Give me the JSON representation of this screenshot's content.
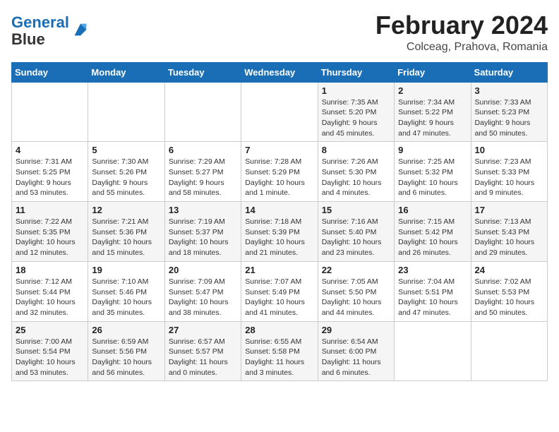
{
  "logo": {
    "line1": "General",
    "line2": "Blue"
  },
  "header": {
    "month": "February 2024",
    "location": "Colceag, Prahova, Romania"
  },
  "weekdays": [
    "Sunday",
    "Monday",
    "Tuesday",
    "Wednesday",
    "Thursday",
    "Friday",
    "Saturday"
  ],
  "weeks": [
    [
      {
        "day": "",
        "detail": ""
      },
      {
        "day": "",
        "detail": ""
      },
      {
        "day": "",
        "detail": ""
      },
      {
        "day": "",
        "detail": ""
      },
      {
        "day": "1",
        "detail": "Sunrise: 7:35 AM\nSunset: 5:20 PM\nDaylight: 9 hours and 45 minutes."
      },
      {
        "day": "2",
        "detail": "Sunrise: 7:34 AM\nSunset: 5:22 PM\nDaylight: 9 hours and 47 minutes."
      },
      {
        "day": "3",
        "detail": "Sunrise: 7:33 AM\nSunset: 5:23 PM\nDaylight: 9 hours and 50 minutes."
      }
    ],
    [
      {
        "day": "4",
        "detail": "Sunrise: 7:31 AM\nSunset: 5:25 PM\nDaylight: 9 hours and 53 minutes."
      },
      {
        "day": "5",
        "detail": "Sunrise: 7:30 AM\nSunset: 5:26 PM\nDaylight: 9 hours and 55 minutes."
      },
      {
        "day": "6",
        "detail": "Sunrise: 7:29 AM\nSunset: 5:27 PM\nDaylight: 9 hours and 58 minutes."
      },
      {
        "day": "7",
        "detail": "Sunrise: 7:28 AM\nSunset: 5:29 PM\nDaylight: 10 hours and 1 minute."
      },
      {
        "day": "8",
        "detail": "Sunrise: 7:26 AM\nSunset: 5:30 PM\nDaylight: 10 hours and 4 minutes."
      },
      {
        "day": "9",
        "detail": "Sunrise: 7:25 AM\nSunset: 5:32 PM\nDaylight: 10 hours and 6 minutes."
      },
      {
        "day": "10",
        "detail": "Sunrise: 7:23 AM\nSunset: 5:33 PM\nDaylight: 10 hours and 9 minutes."
      }
    ],
    [
      {
        "day": "11",
        "detail": "Sunrise: 7:22 AM\nSunset: 5:35 PM\nDaylight: 10 hours and 12 minutes."
      },
      {
        "day": "12",
        "detail": "Sunrise: 7:21 AM\nSunset: 5:36 PM\nDaylight: 10 hours and 15 minutes."
      },
      {
        "day": "13",
        "detail": "Sunrise: 7:19 AM\nSunset: 5:37 PM\nDaylight: 10 hours and 18 minutes."
      },
      {
        "day": "14",
        "detail": "Sunrise: 7:18 AM\nSunset: 5:39 PM\nDaylight: 10 hours and 21 minutes."
      },
      {
        "day": "15",
        "detail": "Sunrise: 7:16 AM\nSunset: 5:40 PM\nDaylight: 10 hours and 23 minutes."
      },
      {
        "day": "16",
        "detail": "Sunrise: 7:15 AM\nSunset: 5:42 PM\nDaylight: 10 hours and 26 minutes."
      },
      {
        "day": "17",
        "detail": "Sunrise: 7:13 AM\nSunset: 5:43 PM\nDaylight: 10 hours and 29 minutes."
      }
    ],
    [
      {
        "day": "18",
        "detail": "Sunrise: 7:12 AM\nSunset: 5:44 PM\nDaylight: 10 hours and 32 minutes."
      },
      {
        "day": "19",
        "detail": "Sunrise: 7:10 AM\nSunset: 5:46 PM\nDaylight: 10 hours and 35 minutes."
      },
      {
        "day": "20",
        "detail": "Sunrise: 7:09 AM\nSunset: 5:47 PM\nDaylight: 10 hours and 38 minutes."
      },
      {
        "day": "21",
        "detail": "Sunrise: 7:07 AM\nSunset: 5:49 PM\nDaylight: 10 hours and 41 minutes."
      },
      {
        "day": "22",
        "detail": "Sunrise: 7:05 AM\nSunset: 5:50 PM\nDaylight: 10 hours and 44 minutes."
      },
      {
        "day": "23",
        "detail": "Sunrise: 7:04 AM\nSunset: 5:51 PM\nDaylight: 10 hours and 47 minutes."
      },
      {
        "day": "24",
        "detail": "Sunrise: 7:02 AM\nSunset: 5:53 PM\nDaylight: 10 hours and 50 minutes."
      }
    ],
    [
      {
        "day": "25",
        "detail": "Sunrise: 7:00 AM\nSunset: 5:54 PM\nDaylight: 10 hours and 53 minutes."
      },
      {
        "day": "26",
        "detail": "Sunrise: 6:59 AM\nSunset: 5:56 PM\nDaylight: 10 hours and 56 minutes."
      },
      {
        "day": "27",
        "detail": "Sunrise: 6:57 AM\nSunset: 5:57 PM\nDaylight: 11 hours and 0 minutes."
      },
      {
        "day": "28",
        "detail": "Sunrise: 6:55 AM\nSunset: 5:58 PM\nDaylight: 11 hours and 3 minutes."
      },
      {
        "day": "29",
        "detail": "Sunrise: 6:54 AM\nSunset: 6:00 PM\nDaylight: 11 hours and 6 minutes."
      },
      {
        "day": "",
        "detail": ""
      },
      {
        "day": "",
        "detail": ""
      }
    ]
  ]
}
